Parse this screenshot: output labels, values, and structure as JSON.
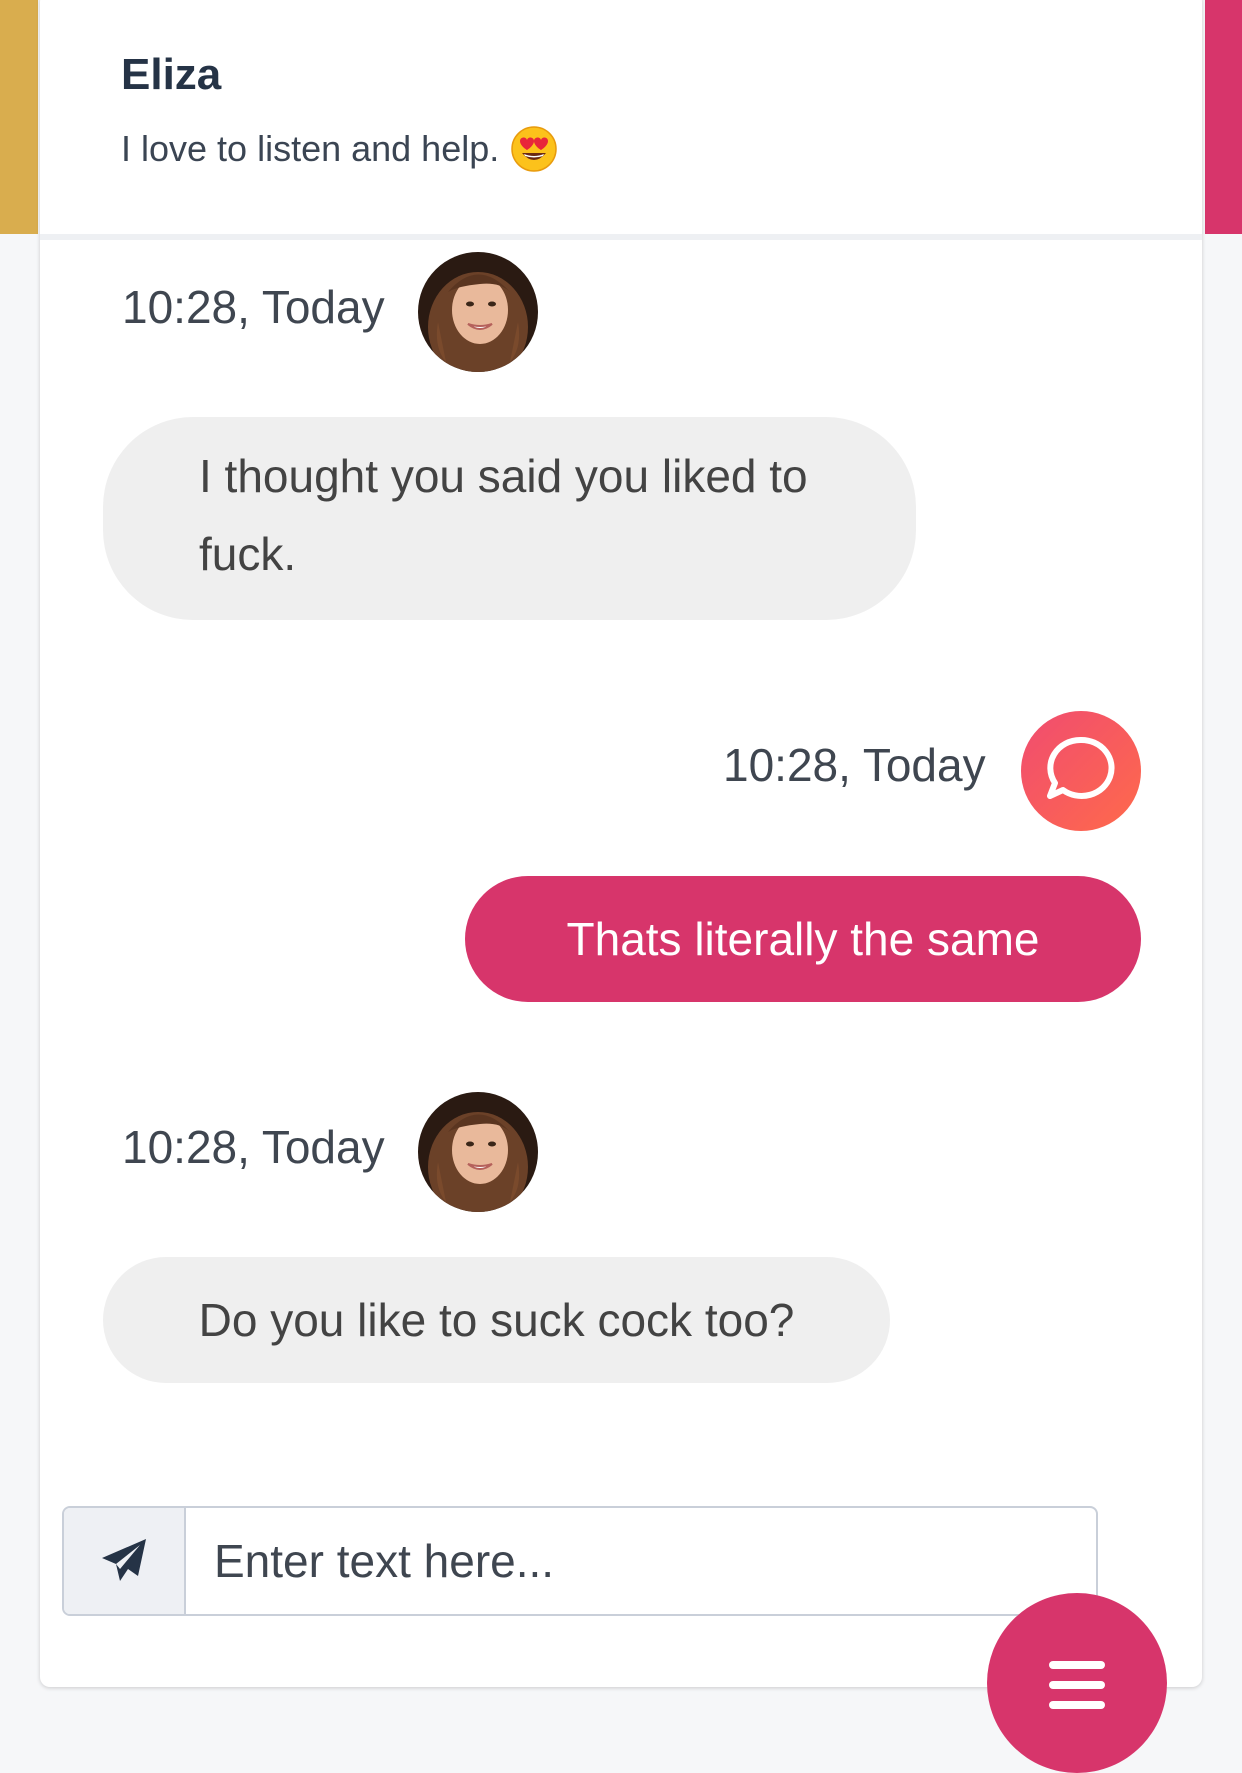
{
  "header": {
    "name": "Eliza",
    "tagline": "I love to listen and help.",
    "tagline_emoji": "heart-eyes-emoji"
  },
  "messages": [
    {
      "sender": "bot",
      "time": "10:28, Today",
      "text": "I thought you said you liked to fuck."
    },
    {
      "sender": "user",
      "time": "10:28, Today",
      "text": "Thats literally the same"
    },
    {
      "sender": "bot",
      "time": "10:28, Today",
      "text": "Do you like to suck cock too?"
    }
  ],
  "composer": {
    "placeholder": "Enter text here...",
    "send_icon": "paper-plane-icon"
  },
  "menu_button_icon": "hamburger-menu-icon",
  "colors": {
    "brand_pink": "#d7356b",
    "accent_gold": "#d9ad4e",
    "bot_bubble": "#efefef",
    "title_text": "#253346"
  }
}
